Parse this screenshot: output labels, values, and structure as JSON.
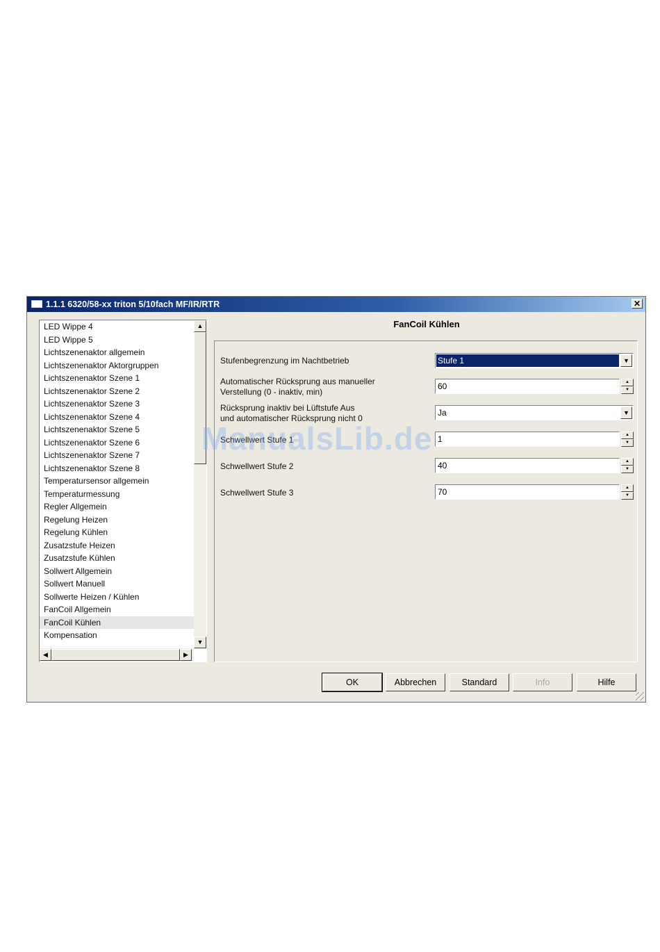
{
  "window": {
    "title": "1.1.1 6320/58-xx triton 5/10fach MF/IR/RTR"
  },
  "list": {
    "items": [
      "LED Wippe 4",
      "LED Wippe 5",
      "Lichtszenenaktor allgemein",
      "Lichtszenenaktor Aktorgruppen",
      "Lichtszenenaktor Szene 1",
      "Lichtszenenaktor Szene 2",
      "Lichtszenenaktor Szene 3",
      "Lichtszenenaktor Szene 4",
      "Lichtszenenaktor Szene 5",
      "Lichtszenenaktor Szene 6",
      "Lichtszenenaktor Szene 7",
      "Lichtszenenaktor Szene 8",
      "Temperatursensor allgemein",
      "Temperaturmessung",
      "Regler Allgemein",
      "Regelung Heizen",
      "Regelung Kühlen",
      "Zusatzstufe Heizen",
      "Zusatzstufe Kühlen",
      "Sollwert Allgemein",
      "Sollwert Manuell",
      "Sollwerte Heizen / Kühlen",
      "FanCoil Allgemein",
      "FanCoil Kühlen",
      "Kompensation"
    ],
    "selected": "FanCoil Kühlen"
  },
  "panel": {
    "title": "FanCoil Kühlen",
    "params": {
      "p1": {
        "label": "Stufenbegrenzung im Nachtbetrieb",
        "value": "Stufe 1"
      },
      "p2": {
        "label1": "Automatischer Rücksprung aus manueller",
        "label2": "Verstellung (0 - inaktiv, min)",
        "value": "60"
      },
      "p3": {
        "label1": "Rücksprung inaktiv bei Lüftstufe Aus",
        "label2": "und automatischer Rücksprung nicht 0",
        "value": "Ja"
      },
      "p4": {
        "label": "Schwellwert Stufe 1",
        "value": "1"
      },
      "p5": {
        "label": "Schwellwert Stufe 2",
        "value": "40"
      },
      "p6": {
        "label": "Schwellwert Stufe 3",
        "value": "70"
      }
    }
  },
  "buttons": {
    "ok": "OK",
    "cancel": "Abbrechen",
    "standard": "Standard",
    "info": "Info",
    "help": "Hilfe"
  },
  "watermark": "ManualsLib.de",
  "icons": {
    "close": "close-icon",
    "scroll_up": "arrow-up-icon",
    "scroll_down": "arrow-down-icon",
    "scroll_left": "arrow-left-icon",
    "scroll_right": "arrow-right-icon",
    "dropdown": "chevron-down-icon"
  }
}
